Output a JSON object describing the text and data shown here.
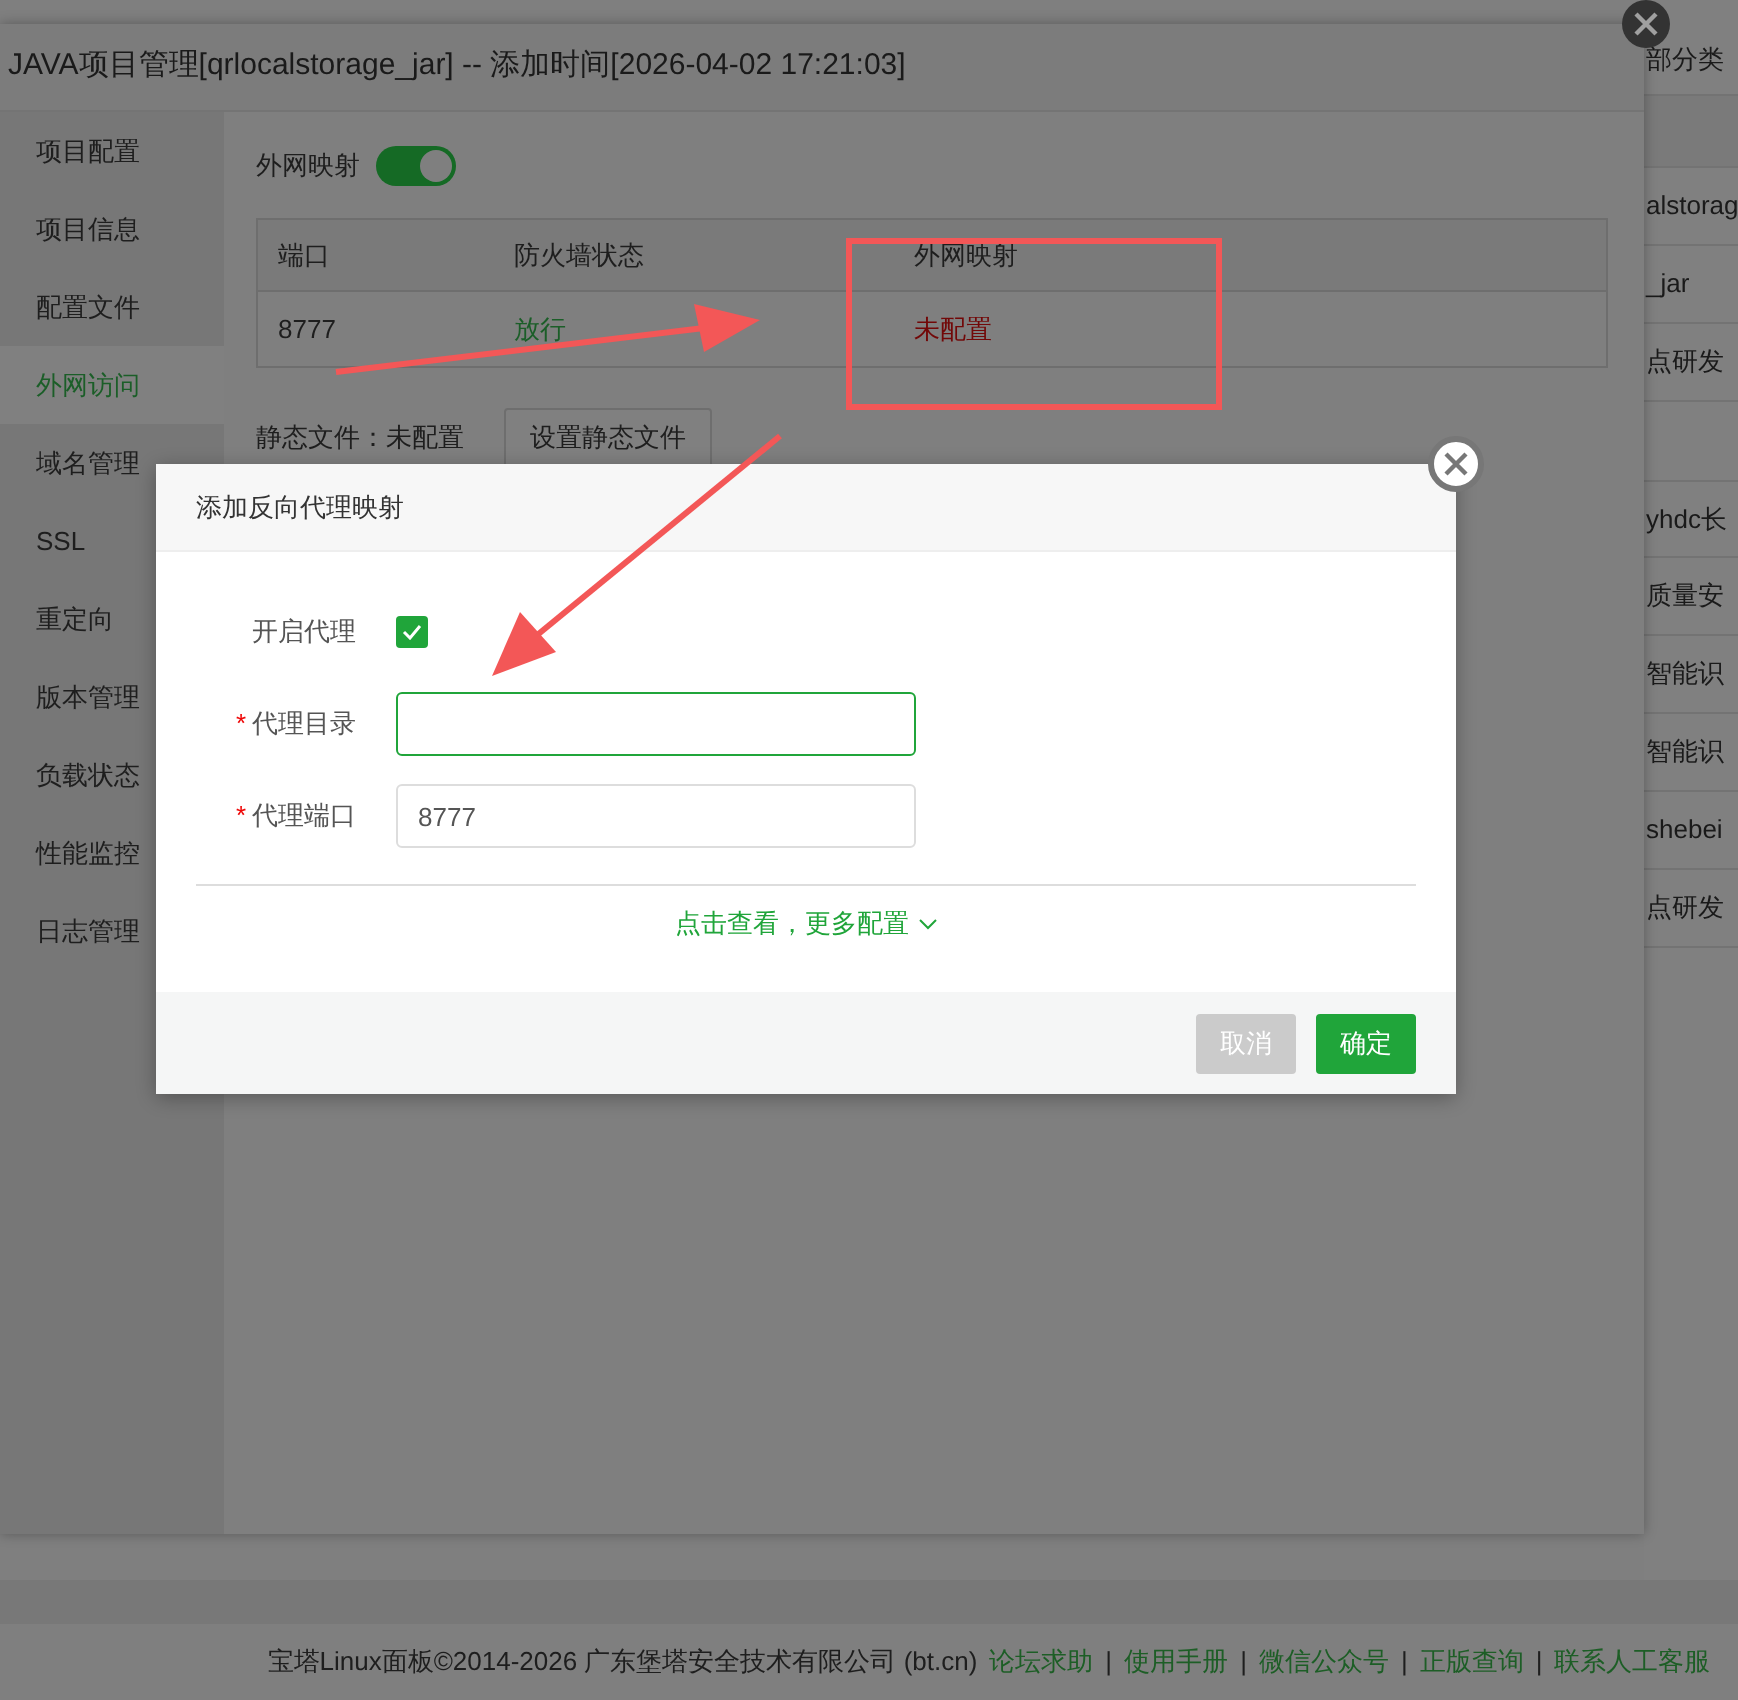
{
  "background_list": {
    "header": "部分类",
    "rows": [
      "alstorag",
      "_jar",
      "点研发",
      "yhdc长",
      "质量安",
      "智能识",
      "智能识",
      "shebei",
      "点研发"
    ]
  },
  "panel": {
    "title": "JAVA项目管理[qrlocalstorage_jar] -- 添加时间[2026-04-02 17:21:03]",
    "tabs": [
      {
        "label": "项目配置",
        "selected": false
      },
      {
        "label": "项目信息",
        "selected": false
      },
      {
        "label": "配置文件",
        "selected": false
      },
      {
        "label": "外网访问",
        "selected": true
      },
      {
        "label": "域名管理",
        "selected": false
      },
      {
        "label": "SSL",
        "selected": false
      },
      {
        "label": "重定向",
        "selected": false
      },
      {
        "label": "版本管理",
        "selected": false
      },
      {
        "label": "负载状态",
        "selected": false
      },
      {
        "label": "性能监控",
        "selected": false
      },
      {
        "label": "日志管理",
        "selected": false
      }
    ],
    "mapping_toggle": {
      "label": "外网映射",
      "on": true
    },
    "table": {
      "columns": [
        "端口",
        "防火墙状态",
        "外网映射"
      ],
      "rows": [
        {
          "port": "8777",
          "firewall": "放行",
          "mapping": "未配置"
        }
      ]
    },
    "static_files": {
      "label": "静态文件：未配置",
      "button": "设置静态文件"
    }
  },
  "dialog": {
    "title": "添加反向代理映射",
    "required_mark": "*",
    "fields": [
      {
        "kind": "checkbox",
        "label": "开启代理",
        "required": false,
        "checked": true
      },
      {
        "kind": "text",
        "label": "代理目录",
        "required": true,
        "focused": true
      },
      {
        "kind": "text",
        "label": "代理端口",
        "required": true,
        "focused": false,
        "value": "8777"
      }
    ],
    "more_link": "点击查看，更多配置",
    "buttons": [
      {
        "label": "取消",
        "kind": "secondary"
      },
      {
        "label": "确定",
        "kind": "primary"
      }
    ]
  },
  "footer": {
    "separator": "|",
    "copyright": "宝塔Linux面板©2014-2026 广东堡塔安全技术有限公司 (bt.cn)",
    "links": [
      "论坛求助",
      "使用手册",
      "微信公众号",
      "正版查询",
      "联系人工客服"
    ]
  }
}
